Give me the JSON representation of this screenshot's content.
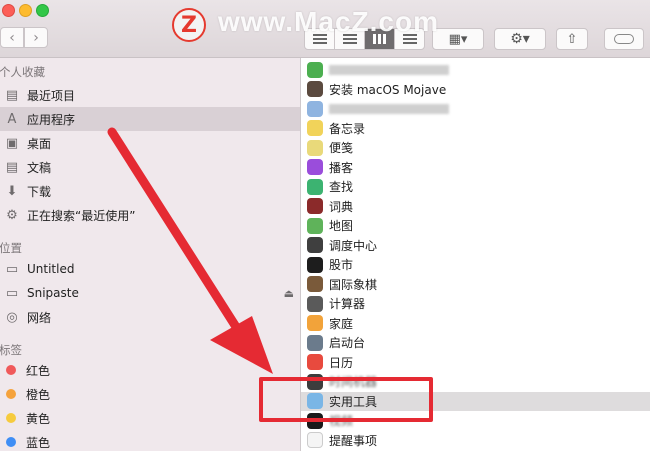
{
  "watermark": {
    "logo_letter": "Z",
    "text": "www.MacZ.com"
  },
  "toolbar": {
    "back_icon": "chevron-left-icon",
    "forward_icon": "chevron-right-icon",
    "view_icons": [
      "icon-view-icon",
      "list-view-icon",
      "column-view-icon",
      "gallery-view-icon"
    ],
    "selected_view": "column-view-icon",
    "group_icon": "group-icon",
    "action_icon": "gear-icon",
    "share_icon": "share-icon",
    "tag_icon": "tag-icon"
  },
  "sidebar": {
    "sections": [
      {
        "title": "个人收藏"
      },
      {
        "title": "位置"
      },
      {
        "title": "标签"
      }
    ],
    "favorites": [
      {
        "label": "最近项目",
        "icon": "recent-icon"
      },
      {
        "label": "应用程序",
        "icon": "applications-icon",
        "selected": true
      },
      {
        "label": "桌面",
        "icon": "desktop-icon"
      },
      {
        "label": "文稿",
        "icon": "document-icon"
      },
      {
        "label": "下载",
        "icon": "download-icon"
      },
      {
        "label": "正在搜索“最近使用”",
        "icon": "gear-icon"
      }
    ],
    "locations": [
      {
        "label": "Untitled",
        "icon": "disk-icon"
      },
      {
        "label": "Snipaste",
        "icon": "disk-icon",
        "eject": true
      },
      {
        "label": "网络",
        "icon": "network-icon"
      }
    ],
    "tags": [
      {
        "label": "红色",
        "color": "#f0595a"
      },
      {
        "label": "橙色",
        "color": "#f5a23c"
      },
      {
        "label": "黄色",
        "color": "#f6cb3e"
      },
      {
        "label": "蓝色",
        "color": "#3f8ef5"
      }
    ]
  },
  "files": [
    {
      "label": "",
      "icon": "app-icon",
      "color": "#4caf50",
      "blurred": true
    },
    {
      "label": "安装 macOS Mojave",
      "icon": "installer-icon",
      "color": "#5b4a3f"
    },
    {
      "label": "",
      "icon": "app-icon",
      "color": "#8fb4e0",
      "blurred": true
    },
    {
      "label": "备忘录",
      "icon": "notes-icon",
      "color": "#f1d35a"
    },
    {
      "label": "便笺",
      "icon": "stickies-icon",
      "color": "#e9d97a"
    },
    {
      "label": "播客",
      "icon": "podcasts-icon",
      "color": "#9a4ddb"
    },
    {
      "label": "查找",
      "icon": "find-my-icon",
      "color": "#3cb371"
    },
    {
      "label": "词典",
      "icon": "dictionary-icon",
      "color": "#8b2a2a"
    },
    {
      "label": "地图",
      "icon": "maps-icon",
      "color": "#5fb35a"
    },
    {
      "label": "调度中心",
      "icon": "mission-control-icon",
      "color": "#3f3f3f"
    },
    {
      "label": "股市",
      "icon": "stocks-icon",
      "color": "#1d1d1d"
    },
    {
      "label": "国际象棋",
      "icon": "chess-icon",
      "color": "#7a5a3a"
    },
    {
      "label": "计算器",
      "icon": "calculator-icon",
      "color": "#5a5a5a"
    },
    {
      "label": "家庭",
      "icon": "home-icon",
      "color": "#f2a33a"
    },
    {
      "label": "启动台",
      "icon": "launchpad-icon",
      "color": "#6b7b8c"
    },
    {
      "label": "日历",
      "icon": "calendar-icon",
      "color": "#e84a3e"
    },
    {
      "label": "时间机器",
      "icon": "time-machine-icon",
      "color": "#3d3d3d",
      "blurred": true
    },
    {
      "label": "实用工具",
      "icon": "utilities-folder-icon",
      "color": "#7ab6e6",
      "highlight": true
    },
    {
      "label": "视频",
      "icon": "video-icon",
      "color": "#1a1a1a",
      "blurred": true
    },
    {
      "label": "提醒事项",
      "icon": "reminders-icon",
      "color": "#f5f5f5"
    }
  ]
}
